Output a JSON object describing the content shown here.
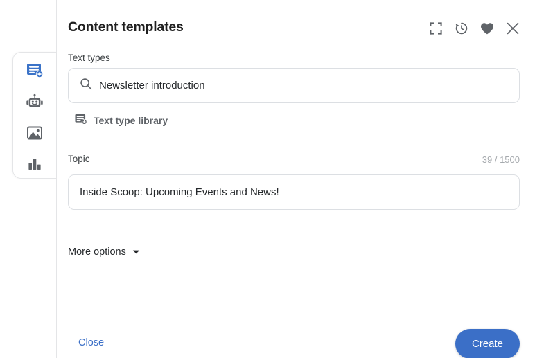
{
  "header": {
    "title": "Content templates",
    "actions": [
      {
        "name": "collapse-icon",
        "label": "Collapse"
      },
      {
        "name": "history-icon",
        "label": "History"
      },
      {
        "name": "favorite-heart-icon",
        "label": "Favorite"
      },
      {
        "name": "close-icon",
        "label": "Close"
      }
    ]
  },
  "sidebar": {
    "items": [
      {
        "icon": "text-template-add-icon",
        "label": "Content templates",
        "active": true
      },
      {
        "icon": "robot-icon",
        "label": "AI chat",
        "active": false
      },
      {
        "icon": "image-icon",
        "label": "Images",
        "active": false
      },
      {
        "icon": "bar-chart-icon",
        "label": "Analytics",
        "active": false
      }
    ]
  },
  "form": {
    "text_types": {
      "label": "Text types",
      "value": "Newsletter introduction",
      "placeholder": "Newsletter introduction",
      "icon": "search-icon"
    },
    "text_type_library": {
      "label": "Text type library",
      "icon": "text-template-add-icon"
    },
    "topic": {
      "label": "Topic",
      "value": "Inside Scoop: Upcoming Events and News!",
      "placeholder": "Inside Scoop: Upcoming Events and News!",
      "counter": "39 / 1500",
      "char_count": 39,
      "char_limit": 1500
    },
    "more_options": {
      "label": "More options",
      "expanded": false,
      "icon": "chevron-down-icon"
    }
  },
  "footer": {
    "close_label": "Close",
    "create_label": "Create"
  },
  "colors": {
    "accent_blue": "#3b6fc7",
    "link_blue": "#3b6fc7",
    "icon_gray": "#5f6368",
    "border_gray": "#dcdfe3",
    "muted_text": "#a6aaae"
  }
}
